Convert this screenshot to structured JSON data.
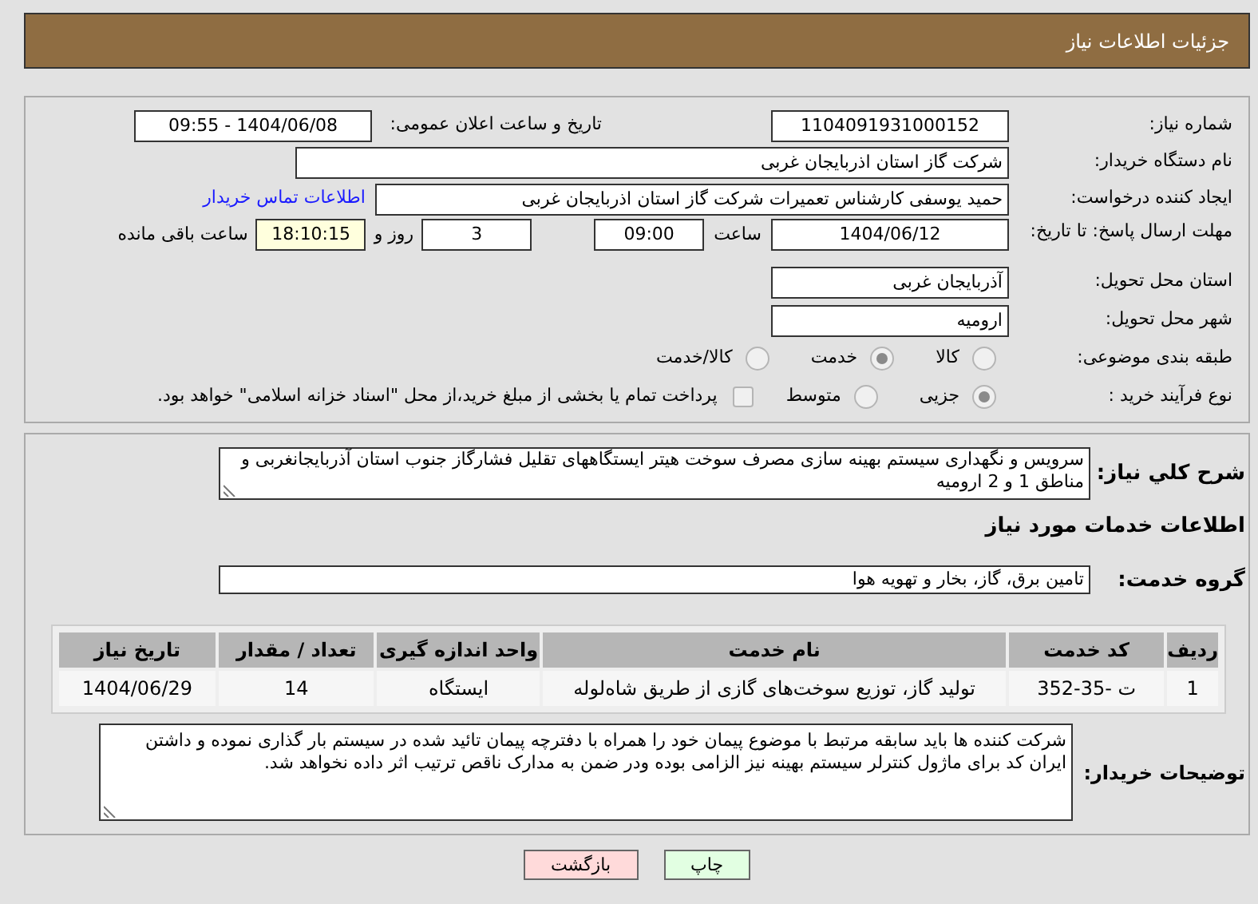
{
  "header": {
    "title": "جزئیات اطلاعات نیاز"
  },
  "need_number": {
    "label": "شماره نیاز:",
    "value": "1104091931000152"
  },
  "announce": {
    "label": "تاریخ و ساعت اعلان عمومی:",
    "value": "1404/06/08 - 09:55"
  },
  "buyer_org": {
    "label": "نام دستگاه خریدار:",
    "value": "شرکت گاز استان اذربایجان غربی"
  },
  "requester": {
    "label": "ایجاد کننده درخواست:",
    "value": "حمید یوسفی کارشناس تعمیرات شرکت گاز استان اذربایجان غربی",
    "contact_link": "اطلاعات تماس خریدار"
  },
  "deadline": {
    "label": "مهلت ارسال پاسخ: تا تاریخ:",
    "date": "1404/06/12",
    "time_label": "ساعت",
    "time": "09:00",
    "days": "3",
    "days_label": "روز و",
    "remaining": "18:10:15",
    "remaining_label": "ساعت باقی مانده"
  },
  "province": {
    "label": "استان محل تحویل:",
    "value": "آذربایجان غربی"
  },
  "city": {
    "label": "شهر محل تحویل:",
    "value": "ارومیه"
  },
  "category": {
    "label": "طبقه بندی موضوعی:",
    "options": [
      {
        "label": "کالا",
        "selected": false
      },
      {
        "label": "خدمت",
        "selected": true
      },
      {
        "label": "کالا/خدمت",
        "selected": false
      }
    ]
  },
  "purchase_type": {
    "label": "نوع فرآیند خرید :",
    "options": [
      {
        "label": "جزیی",
        "selected": true
      },
      {
        "label": "متوسط",
        "selected": false
      }
    ],
    "payment": {
      "label": "پرداخت تمام یا بخشی از مبلغ خرید،از محل \"اسناد خزانه اسلامی\" خواهد بود.",
      "checked": false
    }
  },
  "description": {
    "label": "شرح کلي نياز:",
    "value": "سرویس و نگهداری سیستم بهینه سازی مصرف سوخت هیتر ایستگاههای تقلیل فشارگاز جنوب استان آذربایجانغربی و مناطق 1 و 2 ارومیه"
  },
  "services_heading": "اطلاعات خدمات مورد نياز",
  "service_group": {
    "label": "گروه خدمت:",
    "value": "تامین برق، گاز، بخار و تهویه هوا"
  },
  "table": {
    "columns": [
      "ردیف",
      "کد خدمت",
      "نام خدمت",
      "واحد اندازه گیری",
      "تعداد / مقدار",
      "تاریخ نیاز"
    ],
    "rows": [
      [
        "1",
        "ت -35-352",
        "تولید گاز، توزیع سوخت‌های گازی از طریق شاه‌لوله",
        "ایستگاه",
        "14",
        "1404/06/29"
      ]
    ]
  },
  "buyer_notes": {
    "label": "توضیحات خریدار:",
    "value": "شرکت کننده ها باید سابقه مرتبط با موضوع پیمان خود را همراه با دفترچه پیمان تائید شده در سیستم بار گذاری نموده و داشتن ایران کد برای ماژول کنترلر سیستم بهینه نیز الزامی بوده ودر ضمن به مدارک ناقص ترتیب اثر داده نخواهد شد."
  },
  "buttons": [
    {
      "label": "چاپ",
      "kind": "print"
    },
    {
      "label": "بازگشت",
      "kind": "back"
    }
  ]
}
